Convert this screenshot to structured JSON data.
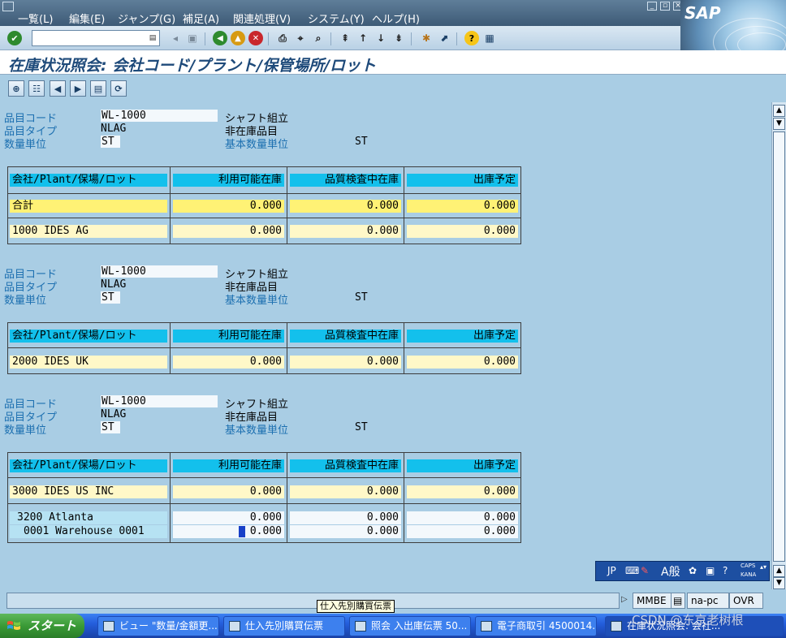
{
  "menu": {
    "items": [
      "一覧(L)",
      "編集(E)",
      "ジャンプ(G)",
      "補足(A)",
      "関連処理(V)",
      "システム(Y)",
      "ヘルプ(H)"
    ],
    "logo_text": "SAP"
  },
  "toolbar": {
    "command_field_value": ""
  },
  "title": "在庫状況照会: 会社コード/プラント/保管場所/ロット",
  "labels": {
    "material_code": "品目コード",
    "material_type": "品目タイプ",
    "quantity_unit": "数量単位",
    "base_unit": "基本数量単位"
  },
  "columns": [
    "会社/Plant/保場/ロット",
    "利用可能在庫",
    "品質検査中在庫",
    "出庫予定"
  ],
  "blocks": [
    {
      "material_code": "WL-1000",
      "material_desc": "シャフト組立",
      "material_type": "NLAG",
      "material_type_desc": "非在庫品目",
      "quantity_unit": "ST",
      "base_unit": "ST",
      "rows": [
        {
          "name": "合計",
          "v1": "0.000",
          "v2": "0.000",
          "v3": "0.000"
        },
        {
          "name": "1000 IDES AG",
          "v1": "0.000",
          "v2": "0.000",
          "v3": "0.000"
        }
      ]
    },
    {
      "material_code": "WL-1000",
      "material_desc": "シャフト組立",
      "material_type": "NLAG",
      "material_type_desc": "非在庫品目",
      "quantity_unit": "ST",
      "base_unit": "ST",
      "rows": [
        {
          "name": "2000 IDES UK",
          "v1": "0.000",
          "v2": "0.000",
          "v3": "0.000"
        }
      ]
    },
    {
      "material_code": "WL-1000",
      "material_desc": "シャフト組立",
      "material_type": "NLAG",
      "material_type_desc": "非在庫品目",
      "quantity_unit": "ST",
      "base_unit": "ST",
      "rows": [
        {
          "name": "3000 IDES US INC",
          "v1": "0.000",
          "v2": "0.000",
          "v3": "0.000"
        }
      ],
      "sub_rows": [
        {
          "name": "3200 Atlanta",
          "v1": "0.000",
          "v2": "0.000",
          "v3": "0.000"
        },
        {
          "name": "0001 Warehouse 0001",
          "v1": "0.000",
          "v2": "0.000",
          "v3": "0.000"
        }
      ]
    }
  ],
  "ime": {
    "lang": "JP",
    "mode": "A般",
    "caps": "CAPS",
    "kana": "KANA"
  },
  "status": {
    "tcode": "MMBE",
    "server": "na-pc",
    "mode": "OVR"
  },
  "tooltip": "仕入先別購買伝票",
  "taskbar": {
    "start": "スタート",
    "tasks": [
      "ビュー \"数量/金額更...",
      "仕入先別購買伝票",
      "照会 入出庫伝票 50...",
      "電子商取引 4500014...",
      "在庫状況照会: 会社..."
    ]
  },
  "watermark": "CSDN @东京老树根",
  "colors": {
    "header_cell": "#13c0ec",
    "total_row": "#fff275",
    "data_row": "#fff8c8",
    "label_text": "#1c6fb0",
    "background": "#a9cde4"
  }
}
